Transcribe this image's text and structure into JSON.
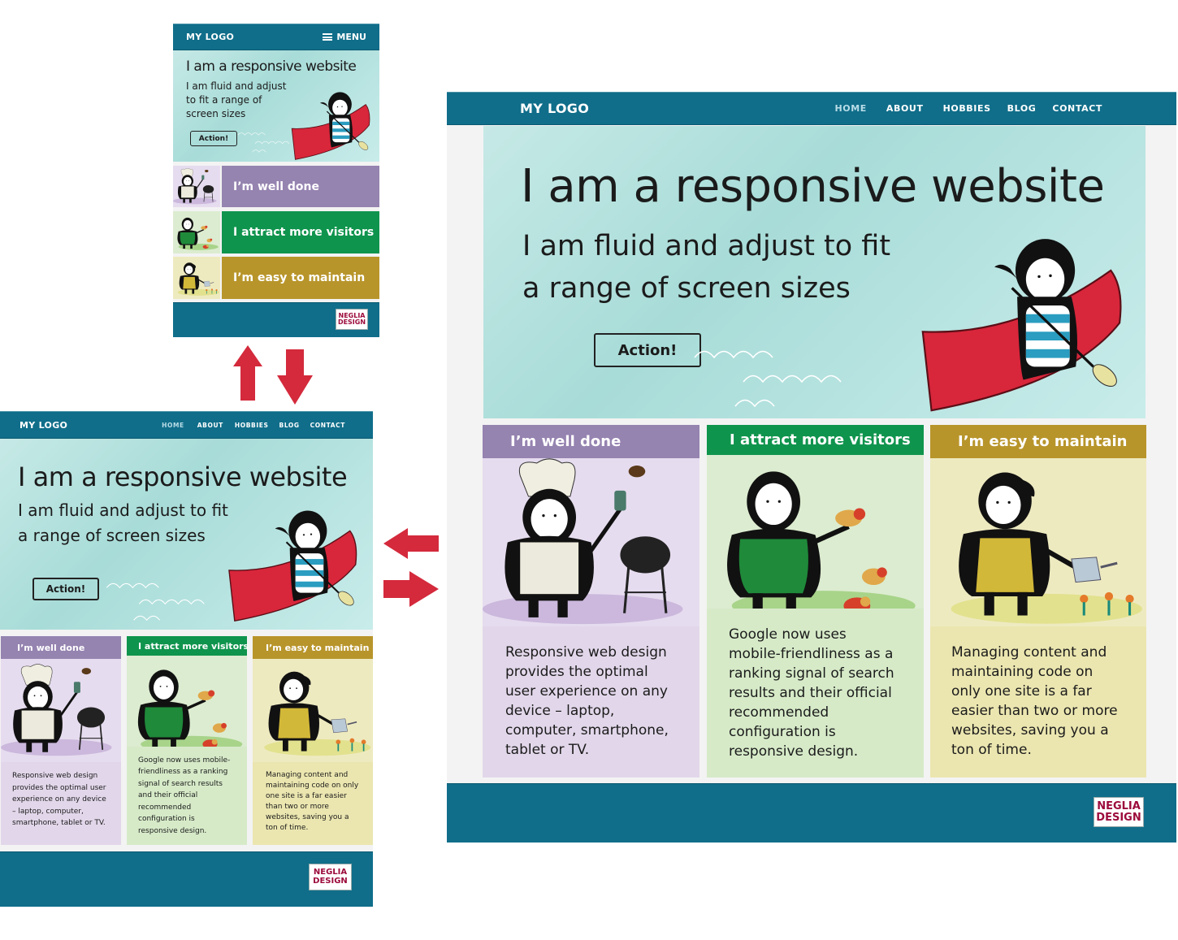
{
  "site": {
    "logo": "MY LOGO",
    "menu_label": "MENU",
    "nav": [
      {
        "label": "HOME",
        "active": true
      },
      {
        "label": "ABOUT",
        "active": false
      },
      {
        "label": "HOBBIES",
        "active": false
      },
      {
        "label": "BLOG",
        "active": false
      },
      {
        "label": "CONTACT",
        "active": false
      }
    ],
    "hero": {
      "title": "I am a responsive website",
      "subtitle_line1": "I am fluid and adjust to fit",
      "subtitle_line2": "a range of screen sizes",
      "mobile_subtitle_line1": "I am fluid and adjust",
      "mobile_subtitle_line2": "to fit a range of",
      "mobile_subtitle_line3": "screen sizes",
      "action_label": "Action!"
    },
    "features": [
      {
        "title": "I’m well done",
        "text": "Responsive web design provides the optimal user experience on any device – laptop, computer, smartphone, tablet or TV.",
        "color": "#9583b0",
        "bg": "#e2d7ea",
        "illustration": "chef-character-grilling"
      },
      {
        "title": "I attract more visitors",
        "text": "Google now uses mobile-friendliness as a ranking signal of search results and their official recommended configuration is responsive design.",
        "color": "#0f944d",
        "bg": "#d6eac8",
        "illustration": "character-with-birds"
      },
      {
        "title": "I’m easy to maintain",
        "text": "Managing content and maintaining code on only one site is a far easier than two or more websites, saving you a ton of time.",
        "color": "#b8952b",
        "bg": "#ebe6b0",
        "illustration": "gardener-watering-flowers"
      }
    ],
    "footer_badge_line1": "NEGLIA",
    "footer_badge_line2": "DESIGN"
  },
  "colors": {
    "header": "#106e8a",
    "arrow": "#d42a3c",
    "page_bg": "#f3f3f3",
    "badge_text": "#9c0b3b"
  },
  "arrows": [
    "arrow-up-icon",
    "arrow-down-icon",
    "arrow-left-icon",
    "arrow-right-icon"
  ]
}
